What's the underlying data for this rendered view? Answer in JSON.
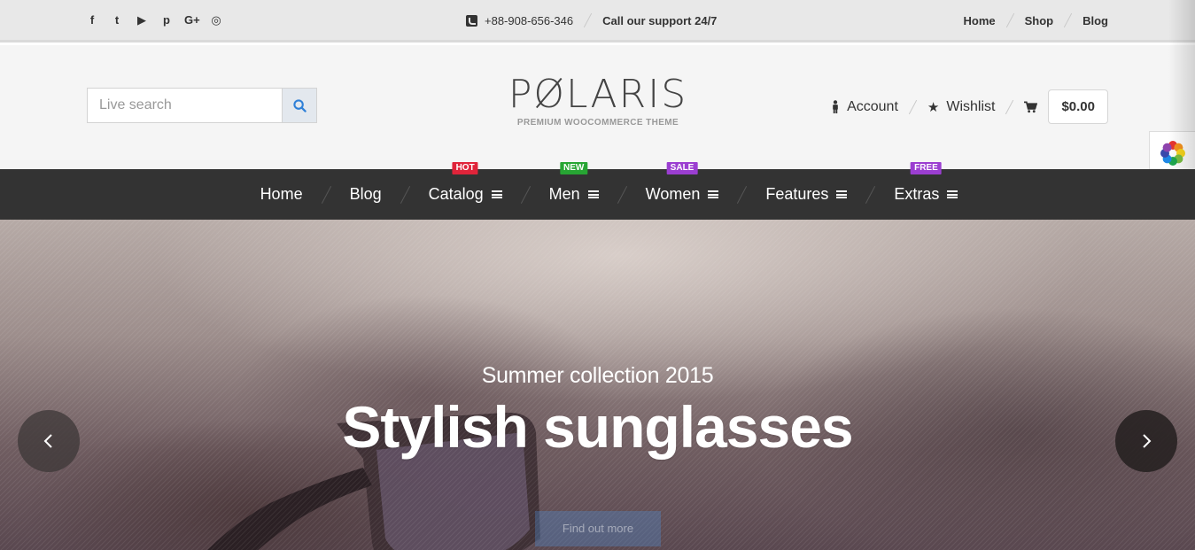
{
  "topbar": {
    "social_icons": [
      "facebook-icon",
      "twitter-icon",
      "youtube-icon",
      "pinterest-icon",
      "google-plus-icon",
      "instagram-icon"
    ],
    "social_glyphs": [
      "f",
      "t",
      "▶",
      "p",
      "G+",
      "◎"
    ],
    "phone": "+88-908-656-346",
    "support": "Call our support 24/7",
    "links": [
      "Home",
      "Shop",
      "Blog"
    ]
  },
  "header": {
    "search_placeholder": "Live search",
    "logo_name": "PØLARIS",
    "logo_tagline": "PREMIUM WOOCOMMERCE THEME",
    "account_label": "Account",
    "wishlist_label": "Wishlist",
    "cart_total": "$0.00"
  },
  "nav": {
    "items": [
      {
        "label": "Home"
      },
      {
        "label": "Blog"
      },
      {
        "label": "Catalog",
        "badge": "HOT",
        "badge_color": "#e0243a"
      },
      {
        "label": "Men",
        "badge": "NEW",
        "badge_color": "#27a533"
      },
      {
        "label": "Women",
        "badge": "SALE",
        "badge_color": "#9b3ed1"
      },
      {
        "label": "Features"
      },
      {
        "label": "Extras",
        "badge": "FREE",
        "badge_color": "#9b3ed1"
      }
    ]
  },
  "hero": {
    "subtitle": "Summer collection 2015",
    "title": "Stylish sunglasses",
    "button_label": "Find out more"
  }
}
